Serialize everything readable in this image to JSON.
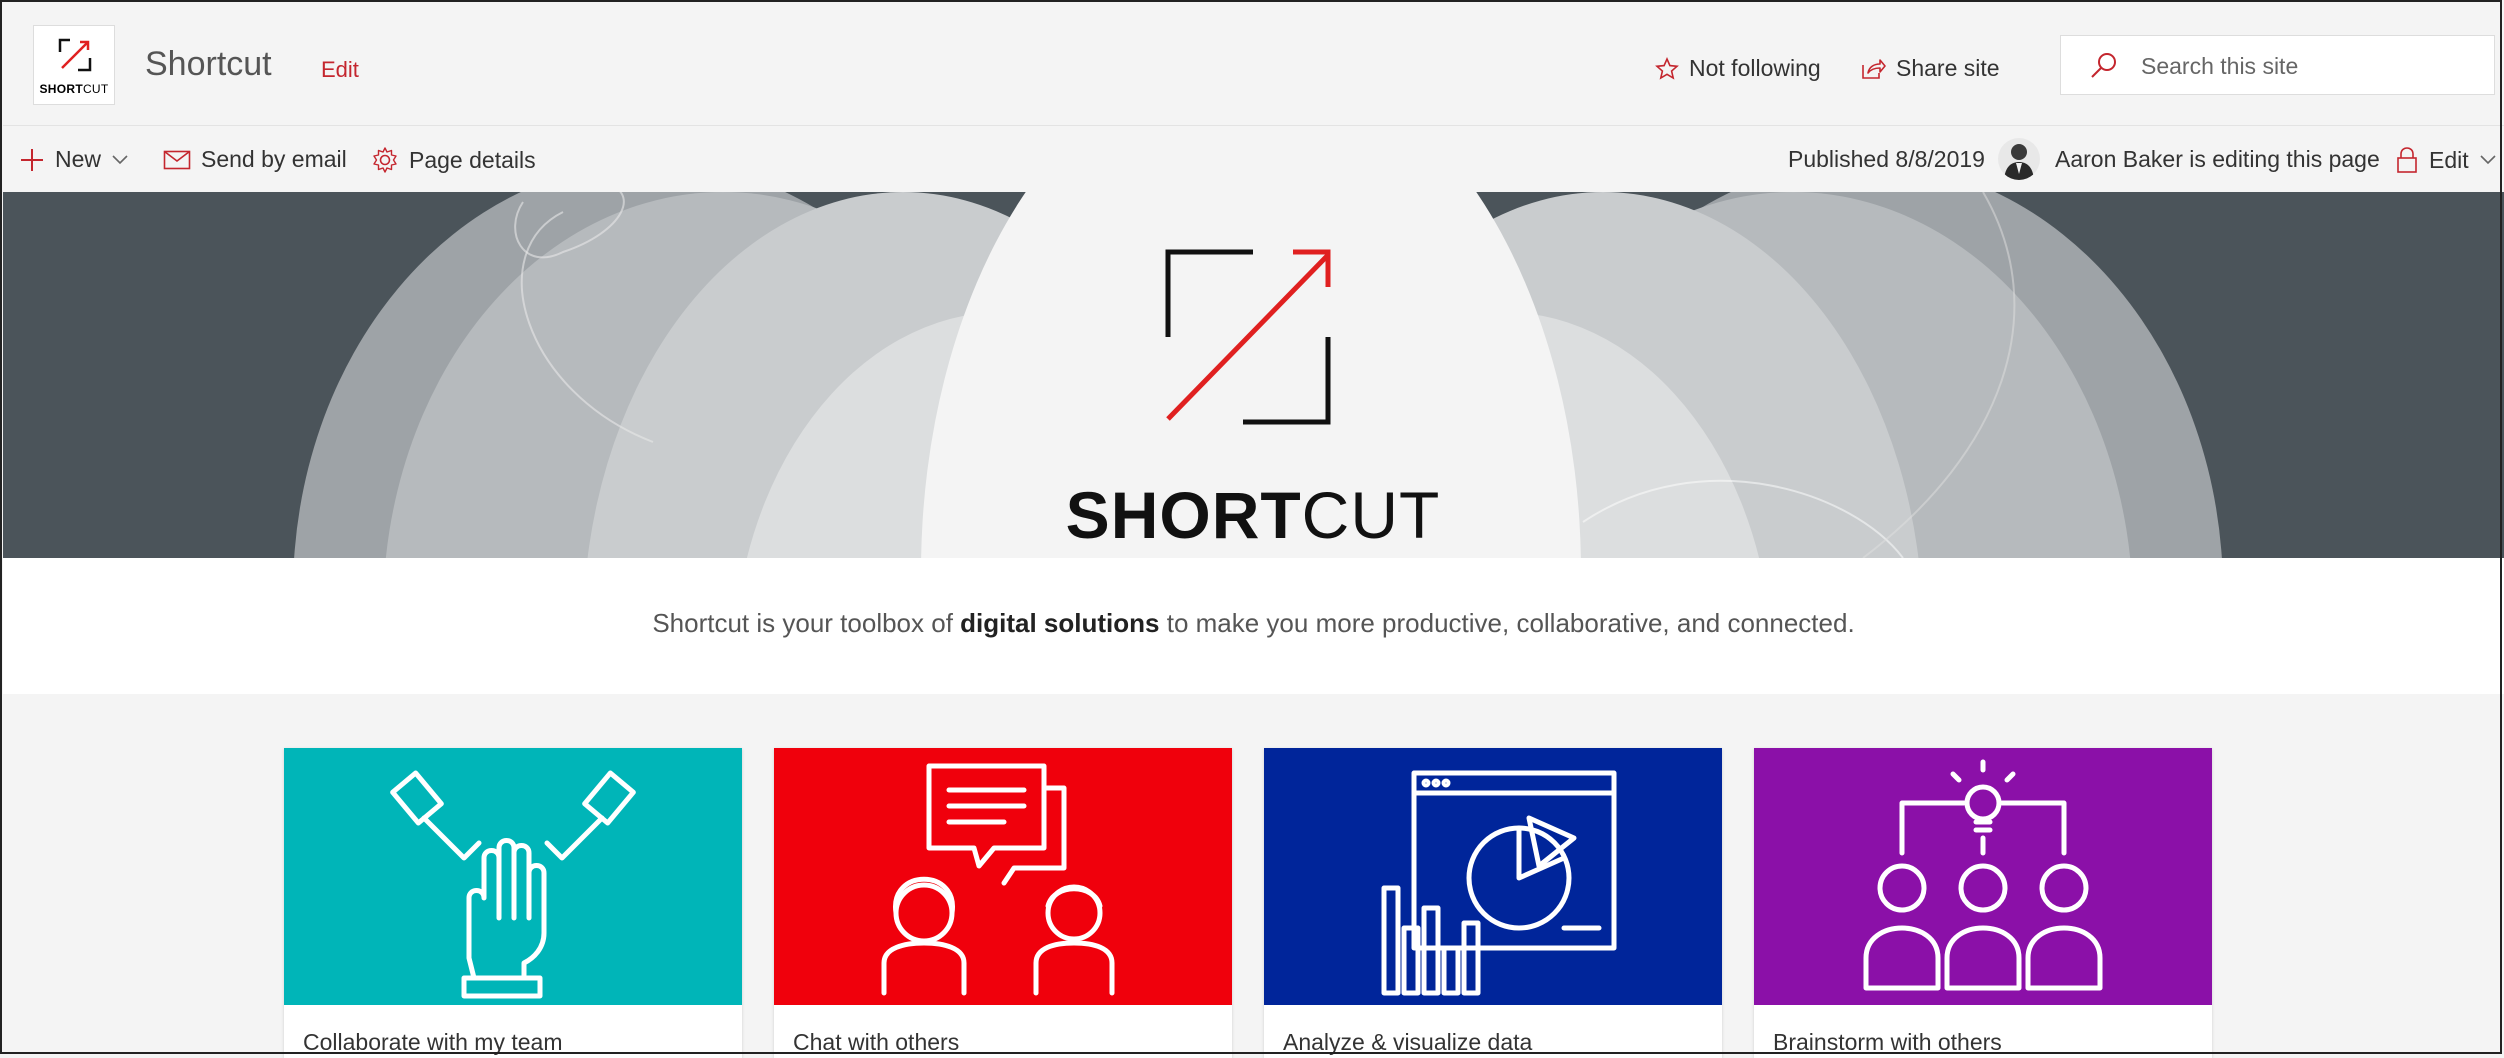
{
  "header": {
    "logo": {
      "brand_bold": "SHORT",
      "brand_light": "CUT"
    },
    "site_title": "Shortcut",
    "edit_link": "Edit",
    "follow_label": "Not following",
    "share_label": "Share site",
    "search_placeholder": "Search this site"
  },
  "command_bar": {
    "new_label": "New",
    "email_label": "Send by email",
    "details_label": "Page details",
    "published": "Published 8/8/2019",
    "editor_status": "Aaron Baker is editing this page",
    "edit_label": "Edit"
  },
  "hero": {
    "brand_bold": "SHORT",
    "brand_light": "CUT"
  },
  "description": {
    "before": "Shortcut is your toolbox of ",
    "bold": "digital solutions",
    "after": " to make you more productive, collaborative, and connected."
  },
  "tiles": [
    {
      "label": "Collaborate with my team",
      "color": "#00b5b8",
      "icon": "hands-together-icon"
    },
    {
      "label": "Chat with others",
      "color": "#f0000c",
      "icon": "chat-people-icon"
    },
    {
      "label": "Analyze & visualize data",
      "color": "#00259a",
      "icon": "data-chart-icon"
    },
    {
      "label": "Brainstorm with others",
      "color": "#8b10a8",
      "icon": "brainstorm-icon"
    }
  ],
  "colors": {
    "accent": "#c4262e",
    "hero_bg": "#4b545a"
  }
}
